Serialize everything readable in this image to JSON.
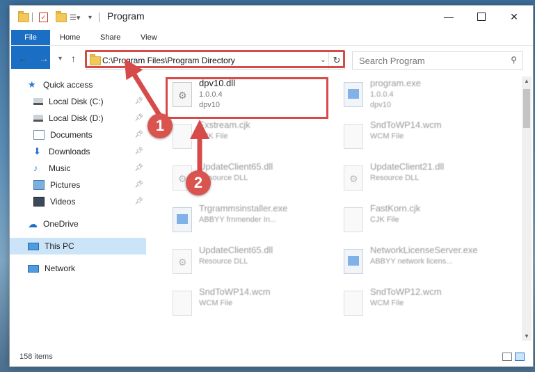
{
  "window": {
    "title": "Program"
  },
  "titlebar": {
    "minimize_icon": "minimize-icon",
    "maximize_icon": "maximize-icon",
    "close_icon": "close-icon"
  },
  "ribbon": {
    "tabs": [
      "File",
      "Home",
      "Share",
      "View"
    ]
  },
  "address": {
    "path": "C:\\Program Files\\Program Directory"
  },
  "search": {
    "placeholder": "Search Program"
  },
  "nav": {
    "items": [
      {
        "label": "Quick access",
        "icon": "star-icon"
      },
      {
        "label": "Local Disk (C:)",
        "icon": "drive-icon"
      },
      {
        "label": "Local Disk (D:)",
        "icon": "drive-icon"
      },
      {
        "label": "Documents",
        "icon": "documents-icon"
      },
      {
        "label": "Downloads",
        "icon": "download-icon"
      },
      {
        "label": "Music",
        "icon": "music-icon"
      },
      {
        "label": "Pictures",
        "icon": "pictures-icon"
      },
      {
        "label": "Videos",
        "icon": "videos-icon"
      },
      {
        "label": "OneDrive",
        "icon": "cloud-icon"
      },
      {
        "label": "This PC",
        "icon": "computer-icon"
      },
      {
        "label": "Network",
        "icon": "network-icon"
      }
    ]
  },
  "files": [
    {
      "name": "dpv10.dll",
      "line1": "1.0.0.4",
      "line2": "dpv10"
    },
    {
      "name": "program.exe",
      "line1": "1.0.0.4",
      "line2": "dpv10"
    },
    {
      "name": "Fxstream.cjk",
      "line1": "CJK File",
      "line2": ""
    },
    {
      "name": "SndToWP14.wcm",
      "line1": "WCM File",
      "line2": ""
    },
    {
      "name": "UpdateClient65.dll",
      "line1": "Resource DLL",
      "line2": ""
    },
    {
      "name": "UpdateClient21.dll",
      "line1": "Resource DLL",
      "line2": ""
    },
    {
      "name": "Trgrammsinstaller.exe",
      "line1": "ABBYY frnmender In...",
      "line2": ""
    },
    {
      "name": "FastKorn.cjk",
      "line1": "CJK File",
      "line2": ""
    },
    {
      "name": "UpdateClient65.dll",
      "line1": "Resource DLL",
      "line2": ""
    },
    {
      "name": "NetworkLicenseServer.exe",
      "line1": "ABBYY network licens...",
      "line2": ""
    },
    {
      "name": "SndToWP14.wcm",
      "line1": "WCM File",
      "line2": ""
    },
    {
      "name": "SndToWP12.wcm",
      "line1": "WCM File",
      "line2": ""
    }
  ],
  "status": {
    "count": "158 items"
  },
  "annotations": {
    "step1": "1",
    "step2": "2",
    "color": "#d64a4a"
  }
}
